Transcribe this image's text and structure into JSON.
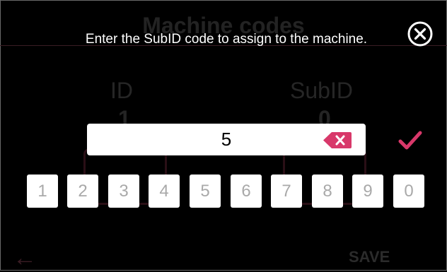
{
  "background_screen": {
    "title": "Machine codes",
    "columns": [
      {
        "label": "ID",
        "value": "1"
      },
      {
        "label": "SubID",
        "value": "0"
      }
    ],
    "save_label": "SAVE"
  },
  "dialog": {
    "prompt": "Enter the SubID code to assign to the machine.",
    "input_value": "5",
    "keys": [
      "1",
      "2",
      "3",
      "4",
      "5",
      "6",
      "7",
      "8",
      "9",
      "0"
    ]
  },
  "colors": {
    "accent": "#d8386a",
    "key_text": "#a9a9a9",
    "overlay": "#000000"
  },
  "icons": {
    "close": "close-circle-icon",
    "backspace": "backspace-icon",
    "confirm": "checkmark-icon",
    "back": "arrow-left-icon"
  }
}
